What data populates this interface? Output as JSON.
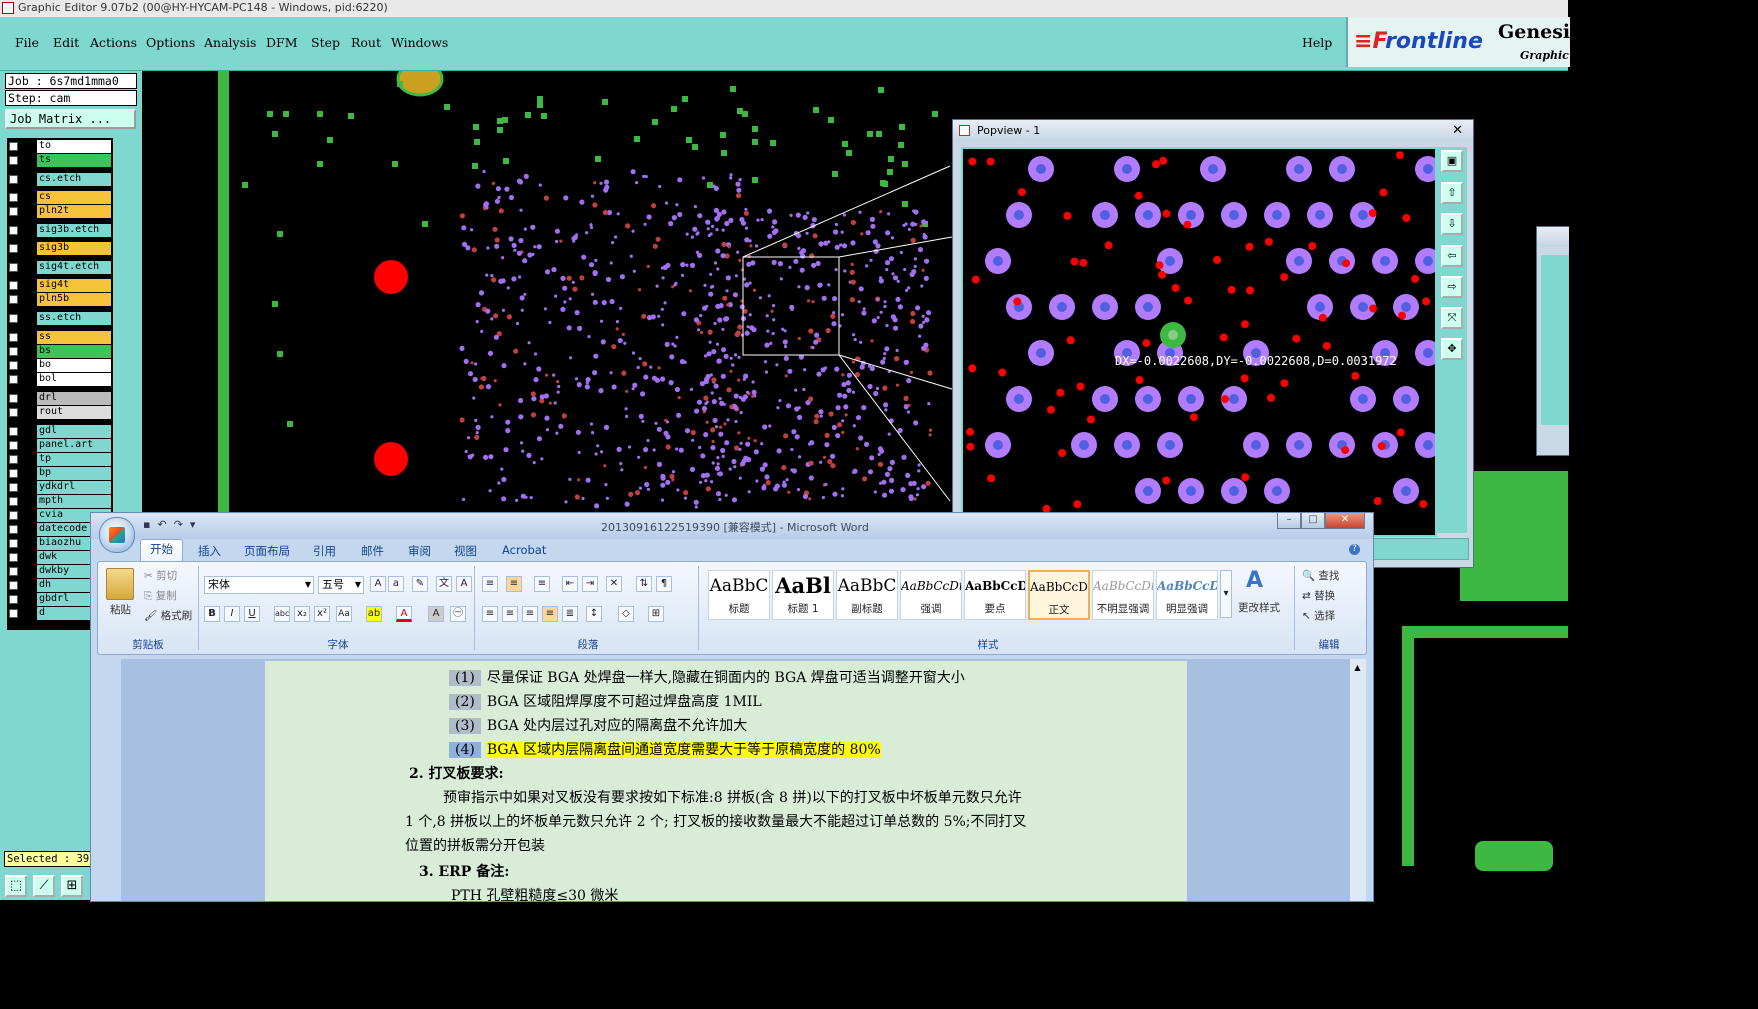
{
  "title": "Graphic Editor 9.07b2 (00@HY-HYCAM-PC148 - Windows, pid:6220)",
  "menu": [
    "File",
    "Edit",
    "Actions",
    "Options",
    "Analysis",
    "DFM",
    "Step",
    "Rout",
    "Windows"
  ],
  "help": "Help",
  "logo": {
    "brand": "Frontline",
    "brand_f": "F",
    "brand_rest": "rontline",
    "product": "Genesis",
    "sub": "Graphic E"
  },
  "job": {
    "job_line": "Job : 6s7md1mma0",
    "step_line": "Step: cam",
    "matrix_button": "Job Matrix ..."
  },
  "layers": [
    {
      "name": "to",
      "color": "#ffffff"
    },
    {
      "name": "ts",
      "color": "#3cc45a"
    },
    {
      "name": "cs.etch",
      "color": "#7fd8d0"
    },
    {
      "name": "cs",
      "color": "#f5c33a"
    },
    {
      "name": "pln2t",
      "color": "#f5c33a"
    },
    {
      "name": "sig3b.etch",
      "color": "#7fd8d0"
    },
    {
      "name": "sig3b",
      "color": "#f5c33a"
    },
    {
      "name": "sig4t.etch",
      "color": "#7fd8d0"
    },
    {
      "name": "sig4t",
      "color": "#f5c33a"
    },
    {
      "name": "pln5b",
      "color": "#f5c33a"
    },
    {
      "name": "ss.etch",
      "color": "#7fd8d0"
    },
    {
      "name": "ss",
      "color": "#f5c33a"
    },
    {
      "name": "bs",
      "color": "#3cc45a"
    },
    {
      "name": "bo",
      "color": "#ffffff"
    },
    {
      "name": "bol",
      "color": "#ffffff"
    },
    {
      "name": "drl",
      "color": "#bbbbbb"
    },
    {
      "name": "rout",
      "color": "#dddddd"
    },
    {
      "name": "gdl",
      "color": "#7fd8d0"
    },
    {
      "name": "panel.art",
      "color": "#7fd8d0"
    },
    {
      "name": "tp",
      "color": "#7fd8d0"
    },
    {
      "name": "bp",
      "color": "#7fd8d0"
    },
    {
      "name": "ydkdrl",
      "color": "#7fd8d0"
    },
    {
      "name": "mpth",
      "color": "#7fd8d0"
    },
    {
      "name": "cvia",
      "color": "#7fd8d0"
    },
    {
      "name": "datecode",
      "color": "#7fd8d0"
    },
    {
      "name": "biaozhu",
      "color": "#7fd8d0"
    },
    {
      "name": "dwk",
      "color": "#7fd8d0"
    },
    {
      "name": "dwkby",
      "color": "#7fd8d0"
    },
    {
      "name": "dh",
      "color": "#7fd8d0"
    },
    {
      "name": "gbdrl",
      "color": "#7fd8d0"
    },
    {
      "name": "d",
      "color": "#7fd8d0"
    }
  ],
  "selected_text": "Selected : 39",
  "popview": {
    "title": "Popview - 1",
    "close": "✕",
    "measure": "DX=-0.0022608,DY=-0.0022608,D=0.0031972"
  },
  "word": {
    "doc_title": "20130916122519390 [兼容模式] - Microsoft Word",
    "tabs": [
      "开始",
      "插入",
      "页面布局",
      "引用",
      "邮件",
      "审阅",
      "视图",
      "Acrobat"
    ],
    "clipboard": {
      "paste": "粘贴",
      "cut": "剪切",
      "copy": "复制",
      "format_painter": "格式刷",
      "label": "剪贴板"
    },
    "font": {
      "name": "宋体",
      "size": "五号",
      "label": "字体"
    },
    "paragraph_label": "段落",
    "styles": [
      {
        "preview": "AaBbC",
        "label": "标题"
      },
      {
        "preview": "AaBl",
        "label": "标题 1"
      },
      {
        "preview": "AaBbC",
        "label": "副标题"
      },
      {
        "preview": "AaBbCcDt",
        "label": "强调"
      },
      {
        "preview": "AaBbCcD",
        "label": "要点"
      },
      {
        "preview": "AaBbCcDt",
        "label": "正文"
      },
      {
        "preview": "AaBbCcDt",
        "label": "不明显强调"
      },
      {
        "preview": "AaBbCcDt",
        "label": "明显强调"
      }
    ],
    "change_styles": "更改样式",
    "styles_label": "样式",
    "editing": {
      "find": "查找",
      "replace": "替换",
      "select": "选择",
      "label": "编辑"
    },
    "content": {
      "items": [
        {
          "num": "(1)",
          "text": "尽量保证 BGA 处焊盘一样大,隐藏在铜面内的 BGA 焊盘可适当调整开窗大小"
        },
        {
          "num": "(2)",
          "text": "BGA 区域阻焊厚度不可超过焊盘高度 1MIL"
        },
        {
          "num": "(3)",
          "text": "BGA 处内层过孔对应的隔离盘不允许加大"
        },
        {
          "num": "(4)",
          "text": "BGA 区域内层隔离盘间通道宽度需要大于等于原稿宽度的 80%"
        }
      ],
      "heading2": "2. 打叉板要求:",
      "para1": "预审指示中如果对叉板没有要求按如下标准:8 拼板(含 8 拼)以下的打叉板中坏板单元数只允许",
      "para2": "1 个,8 拼板以上的坏板单元数只允许 2 个;   打叉板的接收数量最大不能超过订单总数的 5%;不同打叉",
      "para3": "位置的拼板需分开包装",
      "heading3": "3. ERP 备注:",
      "para4": "PTH 孔壁粗糙度≤30 微米"
    }
  }
}
